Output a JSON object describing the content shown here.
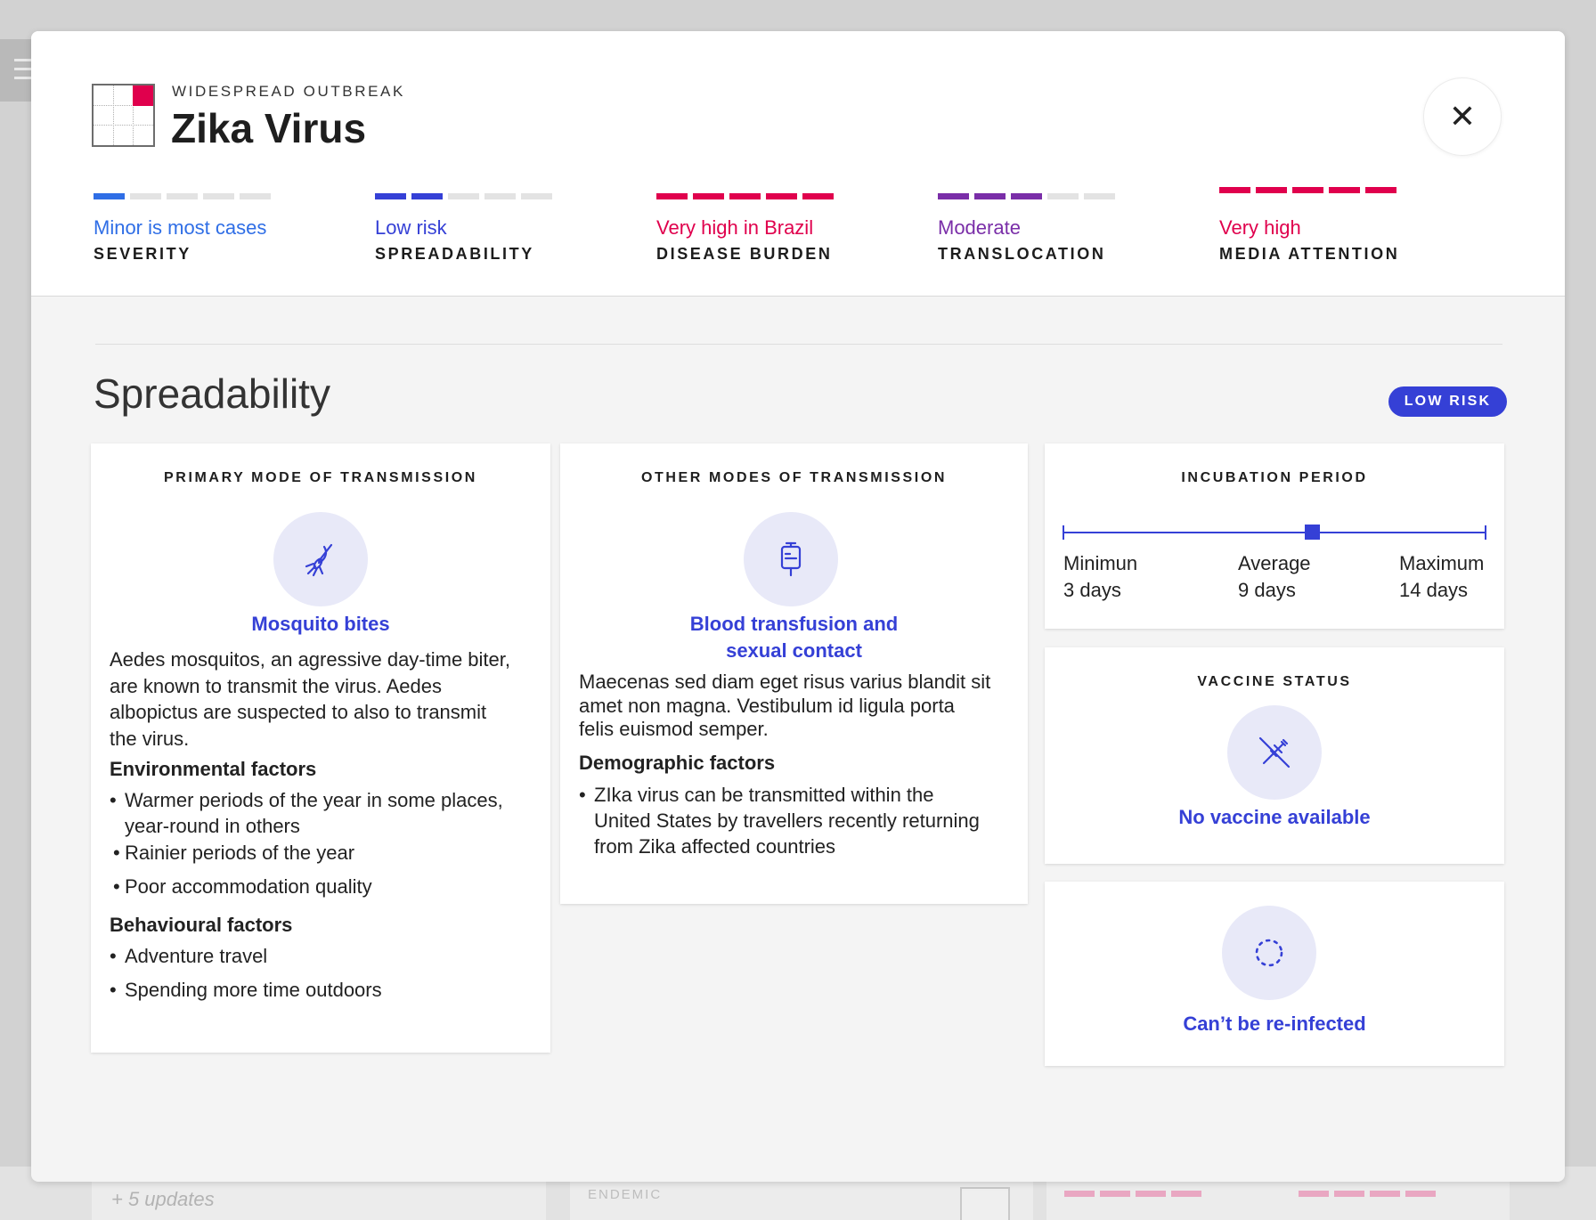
{
  "background": {
    "updates_text": "+ 5 updates",
    "endemic_label": "ENDEMIC"
  },
  "header": {
    "eyebrow": "WIDESPREAD OUTBREAK",
    "title": "Zika Virus",
    "close_icon": "close-icon"
  },
  "metrics": [
    {
      "value": "Minor is most cases",
      "label": "SEVERITY",
      "color": "#2f6ee6",
      "level": 1
    },
    {
      "value": "Low risk",
      "label": "SPREADABILITY",
      "color": "#3540d6",
      "level": 2
    },
    {
      "value": "Very high in Brazil",
      "label": "DISEASE BURDEN",
      "color": "#e0004d",
      "level": 5
    },
    {
      "value": "Moderate",
      "label": "TRANSLOCATION",
      "color": "#7a2ea8",
      "level": 3
    },
    {
      "value": "Very high",
      "label": "MEDIA ATTENTION",
      "color": "#e0004d",
      "level": 5
    }
  ],
  "section": {
    "title": "Spreadability",
    "badge": "LOW RISK"
  },
  "primary": {
    "heading": "PRIMARY MODE OF TRANSMISSION",
    "icon": "mosquito-icon",
    "title": "Mosquito bites",
    "description_lines": [
      "Aedes mosquitos, an agressive day-time biter,",
      "are known to transmit the virus. Aedes",
      "albopictus are suspected to also to transmit",
      "the virus."
    ],
    "env_heading": "Environmental factors",
    "env_items": [
      "Warmer periods of the year in some places,",
      "year-round in others",
      "Rainier periods of the year",
      "Poor accommodation quality"
    ],
    "beh_heading": "Behavioural factors",
    "beh_items": [
      "Adventure travel",
      "Spending more time outdoors"
    ]
  },
  "other": {
    "heading": "OTHER MODES OF TRANSMISSION",
    "icon": "blood-bag-icon",
    "title_line1": "Blood transfusion and",
    "title_line2": "sexual contact",
    "description_lines": [
      "Maecenas sed diam eget risus varius blandit sit",
      "amet non magna. Vestibulum id ligula porta",
      "felis euismod semper."
    ],
    "demo_heading": "Demographic factors",
    "demo_item_lines": [
      "ZIka virus can be transmitted within the",
      "United States by travellers recently returning",
      "from Zika affected countries"
    ]
  },
  "incubation": {
    "heading": "INCUBATION PERIOD",
    "min_label": "Minimun",
    "min_value": "3 days",
    "min_days": 3,
    "avg_label": "Average",
    "avg_value": "9 days",
    "avg_days": 9,
    "max_label": "Maximum",
    "max_value": "14 days",
    "max_days": 14
  },
  "vaccine": {
    "heading": "VACCINE STATUS",
    "icon": "no-vaccine-icon",
    "title": "No vaccine available"
  },
  "reinfection": {
    "icon": "dotted-circle-icon",
    "title": "Can’t be re-infected"
  }
}
